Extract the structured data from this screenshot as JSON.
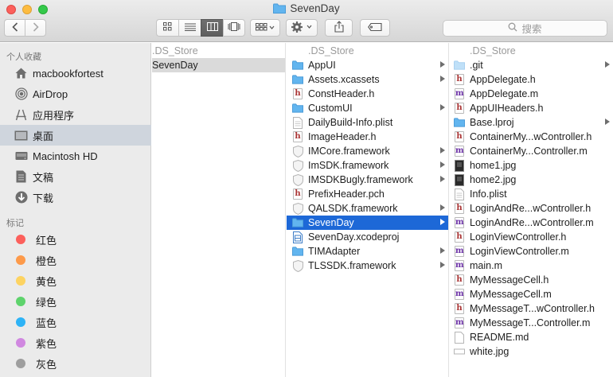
{
  "window": {
    "title": "SevenDay"
  },
  "toolbar": {
    "back_icon": "chevron-left-icon",
    "forward_icon": "chevron-right-icon",
    "view_modes": [
      "icon-view",
      "list-view",
      "column-view",
      "cover-flow-view"
    ],
    "selected_view": "column-view",
    "arrange_icon": "arrange-grid-icon",
    "action_icon": "gear-icon",
    "share_icon": "share-icon",
    "tag_icon": "tag-icon",
    "search_placeholder": "搜索"
  },
  "sidebar": {
    "favorites_header": "个人收藏",
    "favorites": [
      {
        "label": "macbookfortest",
        "icon": "home-icon"
      },
      {
        "label": "AirDrop",
        "icon": "airdrop-icon"
      },
      {
        "label": "应用程序",
        "icon": "applications-icon"
      },
      {
        "label": "桌面",
        "icon": "desktop-icon",
        "selected": true
      },
      {
        "label": "Macintosh HD",
        "icon": "harddisk-icon"
      },
      {
        "label": "文稿",
        "icon": "documents-icon"
      },
      {
        "label": "下载",
        "icon": "downloads-icon"
      }
    ],
    "tags_header": "标记",
    "tags": [
      {
        "label": "红色",
        "color": "#fc605c"
      },
      {
        "label": "橙色",
        "color": "#fd9a4a"
      },
      {
        "label": "黄色",
        "color": "#fdd361"
      },
      {
        "label": "绿色",
        "color": "#5ed36c"
      },
      {
        "label": "蓝色",
        "color": "#2eb3f6"
      },
      {
        "label": "紫色",
        "color": "#d088e0"
      },
      {
        "label": "灰色",
        "color": "#9e9e9e"
      }
    ]
  },
  "columns": [
    {
      "items": [
        {
          "name": ".DS_Store",
          "type": "dim"
        },
        {
          "name": "SevenDay",
          "type": "folder",
          "selected": "inactive"
        }
      ]
    },
    {
      "items": [
        {
          "name": ".DS_Store",
          "type": "dim"
        },
        {
          "name": "AppUI",
          "type": "folder",
          "arrow": true
        },
        {
          "name": "Assets.xcassets",
          "type": "folder",
          "arrow": true
        },
        {
          "name": "ConstHeader.h",
          "type": "h"
        },
        {
          "name": "CustomUI",
          "type": "folder",
          "arrow": true
        },
        {
          "name": "DailyBuild-Info.plist",
          "type": "plist"
        },
        {
          "name": "ImageHeader.h",
          "type": "h"
        },
        {
          "name": "IMCore.framework",
          "type": "framework",
          "arrow": true
        },
        {
          "name": "ImSDK.framework",
          "type": "framework",
          "arrow": true
        },
        {
          "name": "IMSDKBugly.framework",
          "type": "framework",
          "arrow": true
        },
        {
          "name": "PrefixHeader.pch",
          "type": "h"
        },
        {
          "name": "QALSDK.framework",
          "type": "framework",
          "arrow": true
        },
        {
          "name": "SevenDay",
          "type": "folder",
          "arrow": true,
          "selected": "active"
        },
        {
          "name": "SevenDay.xcodeproj",
          "type": "xcodeproj"
        },
        {
          "name": "TIMAdapter",
          "type": "folder",
          "arrow": true
        },
        {
          "name": "TLSSDK.framework",
          "type": "framework",
          "arrow": true
        }
      ]
    },
    {
      "items": [
        {
          "name": ".DS_Store",
          "type": "dim"
        },
        {
          "name": ".git",
          "type": "folderdim",
          "arrow": true
        },
        {
          "name": "AppDelegate.h",
          "type": "h"
        },
        {
          "name": "AppDelegate.m",
          "type": "m"
        },
        {
          "name": "AppUIHeaders.h",
          "type": "h"
        },
        {
          "name": "Base.lproj",
          "type": "folder",
          "arrow": true
        },
        {
          "name": "ContainerMy...wController.h",
          "type": "h"
        },
        {
          "name": "ContainerMy...Controller.m",
          "type": "m"
        },
        {
          "name": "home1.jpg",
          "type": "image"
        },
        {
          "name": "home2.jpg",
          "type": "image"
        },
        {
          "name": "Info.plist",
          "type": "plist"
        },
        {
          "name": "LoginAndRe...wController.h",
          "type": "h"
        },
        {
          "name": "LoginAndRe...wController.m",
          "type": "m"
        },
        {
          "name": "LoginViewController.h",
          "type": "h"
        },
        {
          "name": "LoginViewController.m",
          "type": "m"
        },
        {
          "name": "main.m",
          "type": "m"
        },
        {
          "name": "MyMessageCell.h",
          "type": "h"
        },
        {
          "name": "MyMessageCell.m",
          "type": "m"
        },
        {
          "name": "MyMessageT...wController.h",
          "type": "h"
        },
        {
          "name": "MyMessageT...Controller.m",
          "type": "m"
        },
        {
          "name": "README.md",
          "type": "doc"
        },
        {
          "name": "white.jpg",
          "type": "imagewhite"
        }
      ]
    }
  ]
}
